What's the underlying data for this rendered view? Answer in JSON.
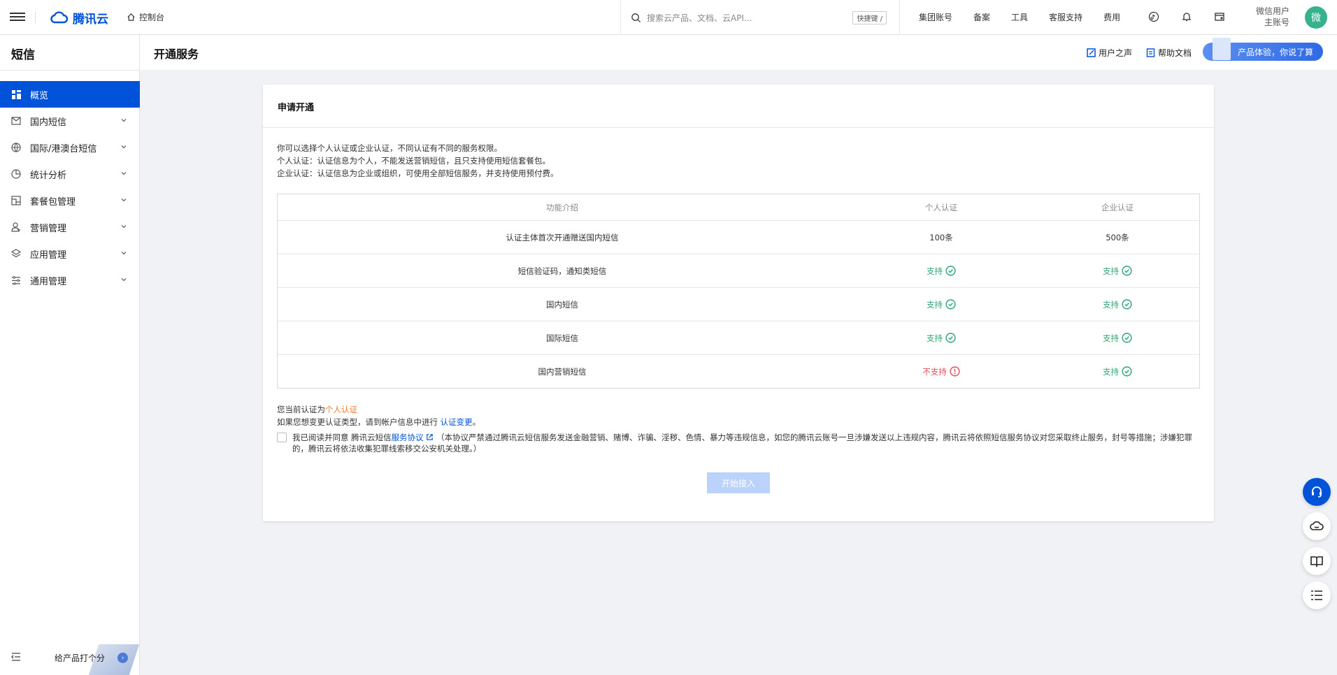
{
  "topbar": {
    "brand": "腾讯云",
    "console": "控制台",
    "search_placeholder": "搜索云产品、文档、云API...",
    "shortcut": "快捷键 /",
    "links": [
      "集团账号",
      "备案",
      "工具",
      "客服支持",
      "费用"
    ],
    "user_name": "微信用户",
    "user_role": "主账号",
    "avatar_text": "微"
  },
  "sidebar": {
    "title": "短信",
    "items": [
      {
        "label": "概览",
        "icon": "dashboard-icon",
        "active": true
      },
      {
        "label": "国内短信",
        "icon": "mail-icon"
      },
      {
        "label": "国际/港澳台短信",
        "icon": "globe-icon"
      },
      {
        "label": "统计分析",
        "icon": "pie-chart-icon"
      },
      {
        "label": "套餐包管理",
        "icon": "package-icon"
      },
      {
        "label": "营销管理",
        "icon": "user-icon"
      },
      {
        "label": "应用管理",
        "icon": "layers-icon"
      },
      {
        "label": "通用管理",
        "icon": "settings-list-icon"
      }
    ],
    "rate_label": "给产品打个分"
  },
  "header": {
    "title": "开通服务",
    "user_voice": "用户之声",
    "help_docs": "帮助文档",
    "feedback": "产品体验，你说了算"
  },
  "card": {
    "title": "申请开通",
    "desc": [
      "你可以选择个人认证或企业认证，不同认证有不同的服务权限。",
      "个人认证：认证信息为个人，不能发送营销短信，且只支持使用短信套餐包。",
      "企业认证：认证信息为企业或组织，可使用全部短信服务，并支持使用预付费。"
    ],
    "table": {
      "headers": [
        "功能介绍",
        "个人认证",
        "企业认证"
      ],
      "rows": [
        {
          "feature": "认证主体首次开通赠送国内短信",
          "personal": "100条",
          "enterprise": "500条"
        },
        {
          "feature": "短信验证码，通知类短信",
          "personal": "支持",
          "enterprise": "支持"
        },
        {
          "feature": "国内短信",
          "personal": "支持",
          "enterprise": "支持"
        },
        {
          "feature": "国际短信",
          "personal": "支持",
          "enterprise": "支持"
        },
        {
          "feature": "国内营销短信",
          "personal": "不支持",
          "enterprise": "支持"
        }
      ]
    },
    "current_prefix": "您当前认证为",
    "current_type": "个人认证",
    "change_prefix": "如果您想变更认证类型，请到帐户信息中进行",
    "change_link": "认证变更",
    "change_suffix": "。",
    "agree_prefix": "我已阅读并同意 腾讯云短信",
    "agree_link": "服务协议",
    "agree_text": "（本协议严禁通过腾讯云短信服务发送金融营销、赌博、诈骗、淫秽、色情、暴力等违规信息，如您的腾讯云账号一旦涉嫌发送以上违规内容，腾讯云将依照短信服务协议对您采取终止服务，封号等措施；涉嫌犯罪的，腾讯云将依法收集犯罪线索移交公安机关处理。）",
    "start_button": "开始接入"
  },
  "colors": {
    "brand": "#0052d9",
    "success": "#2ba471",
    "error": "#e34d59",
    "warning": "#ed7b2f"
  }
}
